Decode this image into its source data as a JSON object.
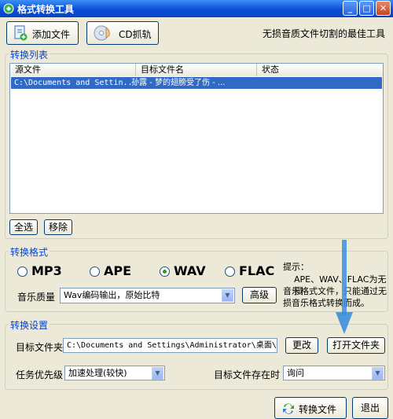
{
  "window": {
    "title": "格式转换工具",
    "minimize_glyph": "_",
    "maximize_glyph": "□",
    "close_glyph": "✕"
  },
  "toolbar": {
    "add_file_label": "添加文件",
    "cd_rip_label": "CD抓轨",
    "slogan": "无损音质文件切割的最佳工具"
  },
  "convert_list": {
    "legend": "转换列表",
    "columns": [
      "源文件",
      "目标文件名",
      "状态"
    ],
    "rows": [
      {
        "source": "C:\\Documents and Settin...",
        "target": "孙露 - 梦的翅膀受了伤 - ...",
        "status": ""
      }
    ],
    "select_all_label": "全选",
    "remove_label": "移除"
  },
  "format": {
    "legend": "转换格式",
    "options": [
      "MP3",
      "APE",
      "WAV",
      "FLAC"
    ],
    "selected": "WAV",
    "quality_label": "音乐质量",
    "quality_value": "Wav编码输出，原始比特",
    "advanced_label": "高级",
    "tip_title": "提示：",
    "tip_lines": [
      "APE、WAV、FLAC为无损",
      "音乐格式文件，只能通过无",
      "损音乐格式转换而成。"
    ]
  },
  "settings": {
    "legend": "转换设置",
    "target_folder_label": "目标文件夹",
    "target_folder_value": "C:\\Documents and Settings\\Administrator\\桌面\\",
    "change_label": "更改",
    "open_folder_label": "打开文件夹",
    "priority_label": "任务优先级",
    "priority_value": "加速处理(较快)",
    "exists_label": "目标文件存在时",
    "exists_value": "询问"
  },
  "footer": {
    "convert_label": "转换文件",
    "exit_label": "退出"
  },
  "icons": {
    "accent": "#0a4fd8",
    "group_label": "#0046d5",
    "selection": "#316ac5",
    "pointer_arrow": "#3b8fe0"
  }
}
